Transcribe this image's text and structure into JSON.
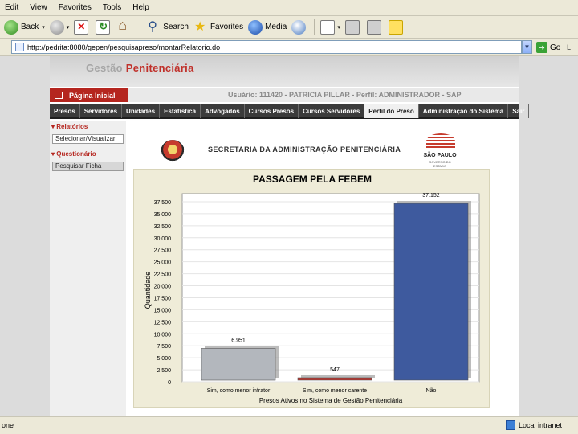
{
  "browser": {
    "menu": [
      "Edit",
      "View",
      "Favorites",
      "Tools",
      "Help"
    ],
    "toolbar": {
      "back": "Back",
      "search": "Search",
      "favorites": "Favorites",
      "media": "Media"
    },
    "address_url": "http://pedrita:8080/gepen/pesquisapreso/montarRelatorio.do",
    "go": "Go",
    "links_label": "L",
    "status_left": "one",
    "status_zone": "Local intranet"
  },
  "site": {
    "title_gray": "Gestão ",
    "title_red": "Penitenciária",
    "home_link": "Página Inicial",
    "user_line": "Usuário: 111420 - PATRICIA PILLAR - Perfil: ADMINISTRADOR - SAP",
    "nav": [
      "Presos",
      "Servidores",
      "Unidades",
      "Estatística",
      "Advogados",
      "Cursos Presos",
      "Cursos Servidores",
      "Perfil do Preso",
      "Administração do Sistema",
      "Sair"
    ],
    "nav_active": "Perfil do Preso",
    "sidebar": {
      "relatorios_head": "▾ Relatórios",
      "relatorios_btn": "Selecionar/Visualizar",
      "questionario_head": "▾ Questionário",
      "questionario_btn": "Pesquisar Ficha"
    },
    "secretaria": "SECRETARIA DA ADMINISTRAÇÃO PENITENCIÁRIA",
    "sp_logo_text": "SÃO PAULO",
    "sp_logo_sub": "GOVERNO DO ESTADO"
  },
  "chart_data": {
    "type": "bar",
    "title": "PASSAGEM PELA FEBEM",
    "ylabel": "Quantidade",
    "xlabel": "Presos Ativos no Sistema de Gestão Penitenciária",
    "categories": [
      "Sim, como menor infrator",
      "Sim, como menor carente",
      "Não"
    ],
    "values": [
      6951,
      547,
      37152
    ],
    "value_labels": [
      "6.951",
      "547",
      "37.152"
    ],
    "bar_colors": [
      "#b3b7bd",
      "#c0302a",
      "#3e5a9e"
    ],
    "yticks": [
      "0",
      "2.500",
      "5.000",
      "7.500",
      "10.000",
      "12.500",
      "15.000",
      "17.500",
      "20.000",
      "22.500",
      "25.000",
      "27.500",
      "30.000",
      "32.500",
      "35.000",
      "37.500"
    ],
    "ylim": [
      0,
      37500
    ],
    "grid": true
  }
}
